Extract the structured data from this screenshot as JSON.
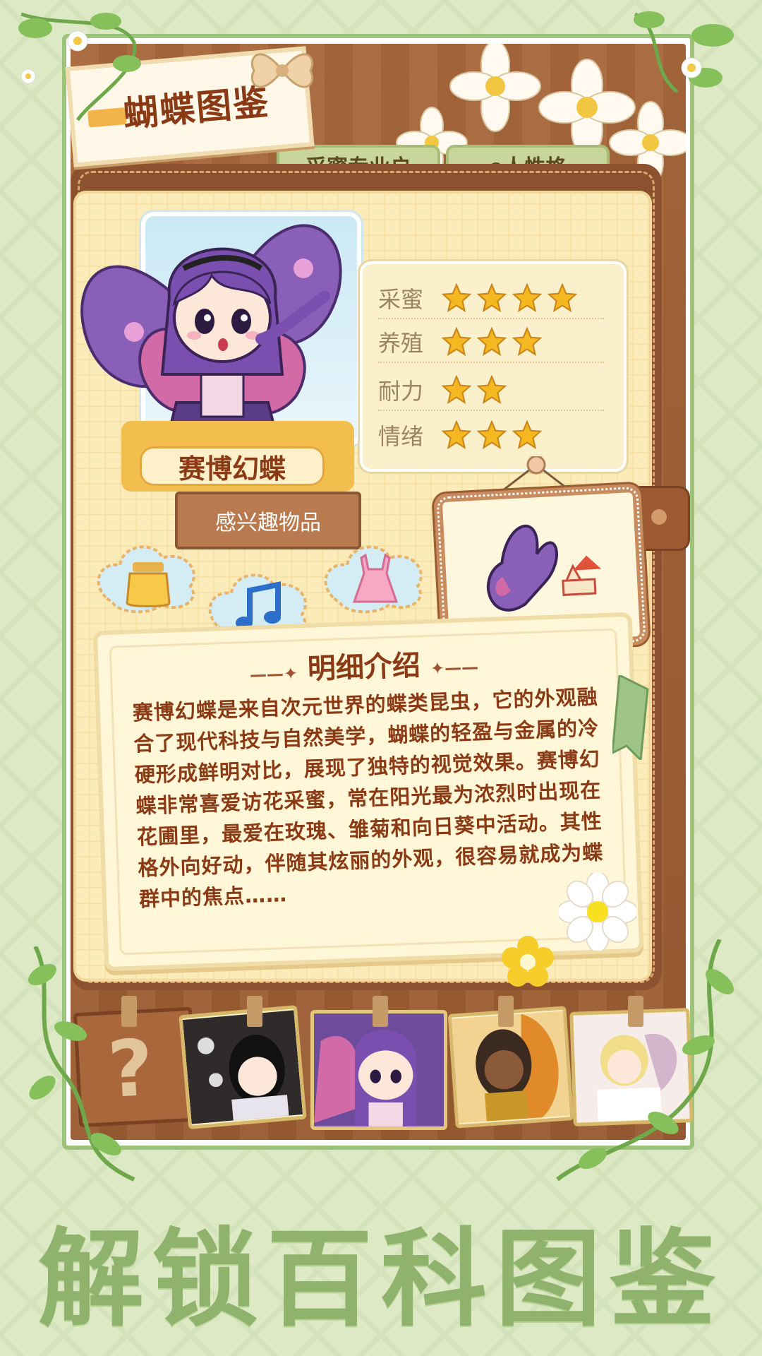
{
  "header": {
    "title": "蝴蝶图鉴"
  },
  "tags": [
    "采蜜专业户",
    "e人性格"
  ],
  "character": {
    "name": "赛博幻蝶"
  },
  "stats": [
    {
      "label": "采蜜",
      "stars": 4
    },
    {
      "label": "养殖",
      "stars": 3
    },
    {
      "label": "耐力",
      "stars": 2
    },
    {
      "label": "情绪",
      "stars": 3
    }
  ],
  "interest": {
    "label": "感兴趣物品",
    "items": [
      "honey-jar-icon",
      "music-note-icon",
      "pink-dress-icon"
    ]
  },
  "detail": {
    "title": "明细介绍",
    "body": "赛博幻蝶是来自次元世界的蝶类昆虫，它的外观融合了现代科技与自然美学，蝴蝶的轻盈与金属的冷硬形成鲜明对比，展现了独特的视觉效果。赛博幻蝶非常喜爱访花采蜜，常在阳光最为浓烈时出现在花圃里，最爱在玫瑰、雏菊和向日葵中活动。其性格外向好动，伴随其炫丽的外观，很容易就成为蝶群中的焦点……"
  },
  "thumbnails": [
    {
      "label": "?",
      "state": "locked"
    },
    {
      "state": "unlocked"
    },
    {
      "state": "selected"
    },
    {
      "state": "unlocked"
    },
    {
      "state": "unlocked"
    }
  ],
  "banner": {
    "text": "解锁百科图鉴"
  },
  "colors": {
    "accent": "#8a3a14",
    "star": "#f5b820",
    "green": "#8fb36c"
  }
}
